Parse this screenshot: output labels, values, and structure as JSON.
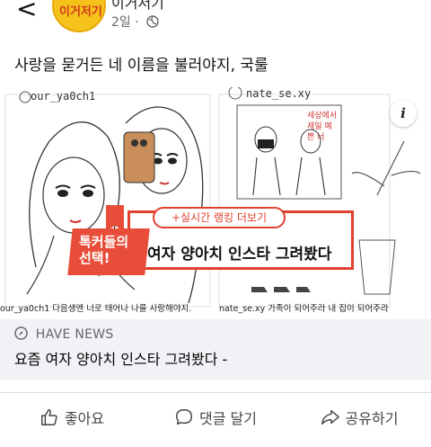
{
  "header": {
    "back_label": "<",
    "avatar_text": "이거저기",
    "author": "이거저기",
    "timestamp": "2일",
    "privacy_icon": "globe-icon",
    "more_label": "···"
  },
  "post": {
    "text": "사랑을 묻거든 네 이름을 불러야지, 국룰"
  },
  "card": {
    "handle_left": "our_ya0ch1",
    "handle_right": "nate_se.xy",
    "caption_left": "our_ya0ch1 다음생엔 너로 태어나 나를 사랑해야지.",
    "caption_right": "nate_se.xy 가족이 되어주라 내 집이 되어주라",
    "poster_text": "세상에서 제일 예쁜 너",
    "banner_pill": "+실시간 랭킹 더보기",
    "banner_badge": "톡커들의\n선택!",
    "banner_headline": "여자 양아치 인스타 그려봤다",
    "info_label": "i",
    "source_name": "HAVE NEWS",
    "title": "요즘 여자 양아치 인스타 그려봤다 -"
  },
  "actions": [
    {
      "label": "좋아요",
      "icon": "thumbs-up-icon"
    },
    {
      "label": "댓글 달기",
      "icon": "comment-icon"
    },
    {
      "label": "공유하기",
      "icon": "share-icon"
    }
  ],
  "colors": {
    "accent_red": "#e0402e",
    "meta_gray": "#65676b",
    "card_footer_bg": "#f0f2f5"
  }
}
